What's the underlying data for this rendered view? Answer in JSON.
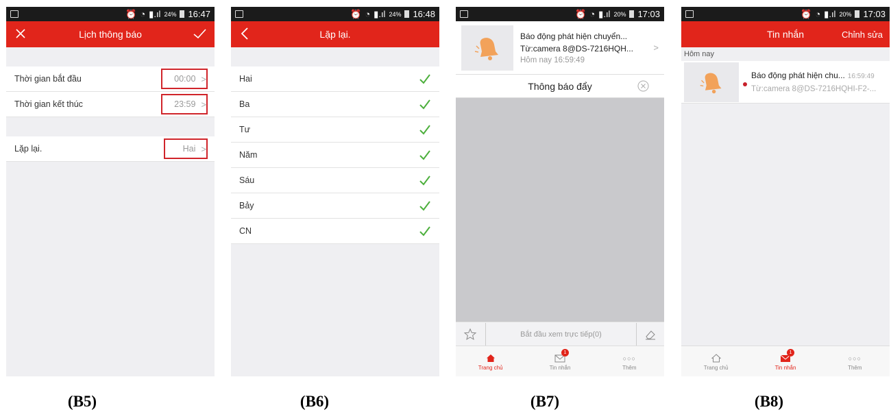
{
  "status": {
    "s1": {
      "battery": "24%",
      "time": "16:47"
    },
    "s2": {
      "battery": "24%",
      "time": "16:48"
    },
    "s3": {
      "battery": "20%",
      "time": "17:03"
    },
    "s4": {
      "battery": "20%",
      "time": "17:03"
    }
  },
  "b5": {
    "title": "Lịch thông báo",
    "rows": [
      {
        "label": "Thời gian bắt đầu",
        "value": "00:00"
      },
      {
        "label": "Thời gian kết thúc",
        "value": "23:59"
      },
      {
        "label": "Lặp lại.",
        "value": "Hai"
      }
    ],
    "caption": "(B5)"
  },
  "b6": {
    "title": "Lặp lại.",
    "days": [
      "Hai",
      "Ba",
      "Tư",
      "Năm",
      "Sáu",
      "Bảy",
      "CN"
    ],
    "caption": "(B6)"
  },
  "b7": {
    "notif_title": "Báo động phát hiện chuyển...",
    "notif_source": "Từ:camera 8@DS-7216HQH...",
    "notif_time": "Hôm nay 16:59:49",
    "push_header": "Thông báo đẩy",
    "live_button": "Bắt đầu xem trực tiếp(0)",
    "caption": "(B7)"
  },
  "b8": {
    "title": "Tin nhắn",
    "edit": "Chỉnh sửa",
    "section": "Hôm nay",
    "msg_title": "Báo động phát hiện chu...",
    "msg_time": "16:59:49",
    "msg_source": "Từ:camera 8@DS-7216HQHI-F2-...",
    "caption": "(B8)"
  },
  "tabs": {
    "home": "Trang chủ",
    "messages": "Tin nhắn",
    "more": "Thêm",
    "badge": "1"
  },
  "colors": {
    "accent": "#e1251b",
    "check": "#4caf3c",
    "highlight_box": "#d0242a"
  }
}
